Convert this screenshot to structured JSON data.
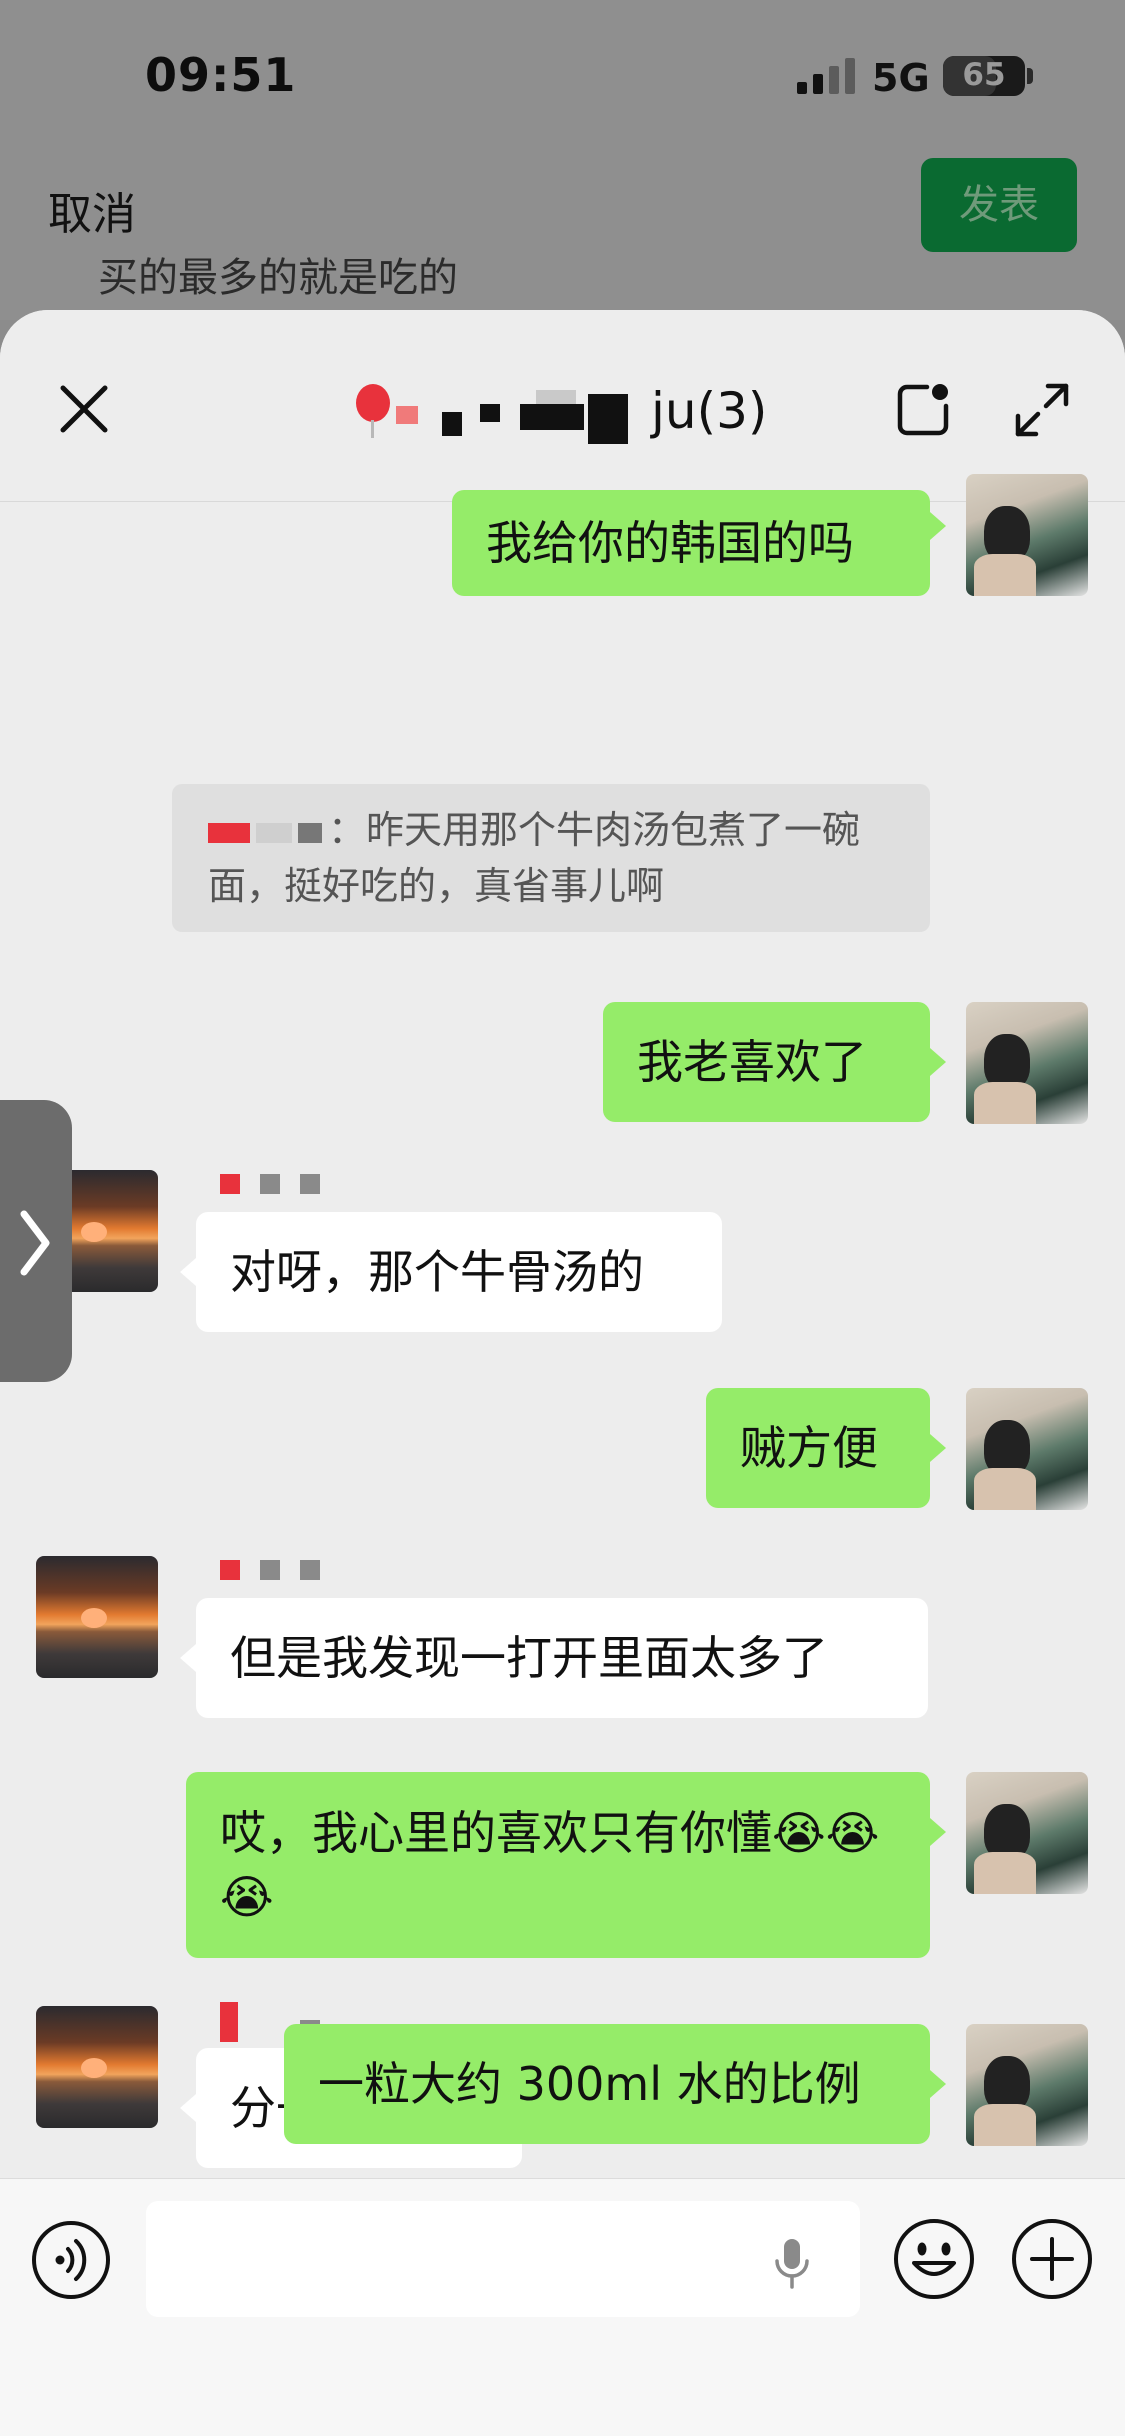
{
  "status_bar": {
    "time": "09:51",
    "network": "5G",
    "battery": "65",
    "battery_level": 0.65
  },
  "compose": {
    "cancel_label": "取消",
    "publish_label": "发表",
    "draft_text": "买的最多的就是吃的"
  },
  "chat": {
    "title": "ju(3)",
    "messages": [
      {
        "direction": "out",
        "text": "我给你的韩国的吗"
      },
      {
        "direction": "quote",
        "text": "：昨天用那个牛肉汤包煮了一碗面，挺好吃的，真省事儿啊"
      },
      {
        "direction": "out",
        "text": "我老喜欢了"
      },
      {
        "direction": "in",
        "text": "对呀，那个牛骨汤的"
      },
      {
        "direction": "out",
        "text": "贼方便"
      },
      {
        "direction": "in",
        "text": "但是我发现一打开里面太多了"
      },
      {
        "direction": "out",
        "text": "哎，我心里的喜欢只有你懂😭😭😭"
      },
      {
        "direction": "in",
        "text": "分一分正好"
      },
      {
        "direction": "out",
        "text": "一粒大约 300ml 水的比例"
      }
    ]
  },
  "colors": {
    "outgoing_bubble": "#95ec69",
    "incoming_bubble": "#ffffff",
    "publish_button": "#0a6a31",
    "sheet_background": "#ededed"
  },
  "icons": {
    "close": "close-icon",
    "note": "note-icon",
    "expand": "expand-icon",
    "voice": "voice-icon",
    "mic": "mic-icon",
    "emoji": "emoji-icon",
    "plus": "plus-icon",
    "chevron": "chevron-right-icon"
  }
}
